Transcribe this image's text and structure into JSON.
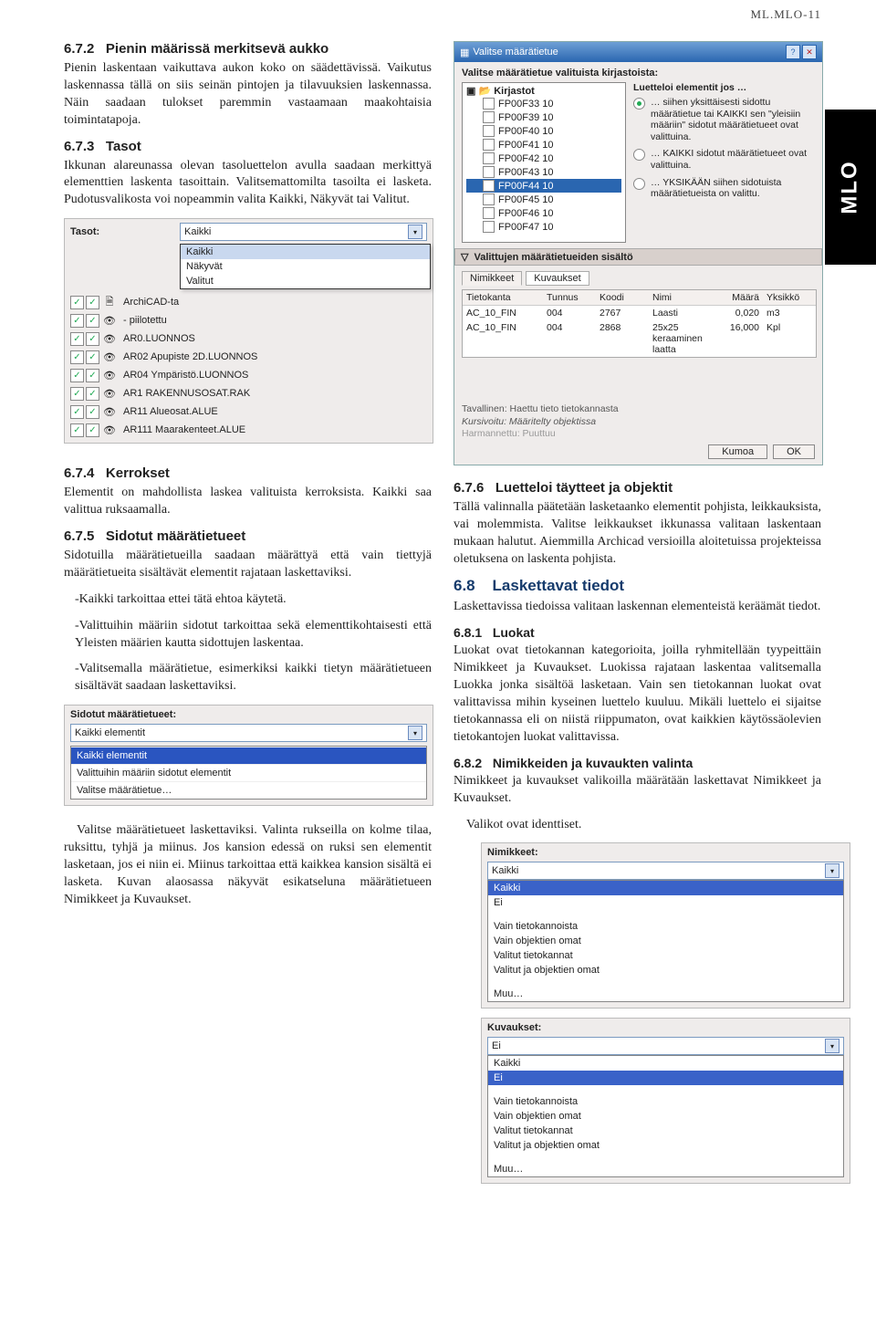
{
  "header_id": "ML.MLO-11",
  "side_tab": "MLO",
  "sec672": {
    "num": "6.7.2",
    "title": "Pienin määrissä merkitsevä aukko",
    "p": "Pienin laskentaan vaikuttava aukon koko on säädettävissä. Vaikutus laskennassa tällä on  siis seinän pintojen ja tilavuuksien laskennassa. Näin saadaan tulokset paremmin vastaamaan maakohtaisia toimintatapoja."
  },
  "sec673": {
    "num": "6.7.3",
    "title": "Tasot",
    "p": "Ikkunan alareunassa olevan tasoluettelon avulla saadaan merkittyä elementtien laskenta tasoittain. Valitsemattomilta tasoilta ei lasketa. Pudotusvalikosta voi nopeammin valita Kaikki, Näkyvät tai Valitut."
  },
  "tasot": {
    "label": "Tasot:",
    "value": "Kaikki",
    "options": [
      "Kaikki",
      "Näkyvät",
      "Valitut"
    ],
    "layers": [
      {
        "chk": true,
        "icon": "doc",
        "name": "ArchiCAD-ta"
      },
      {
        "chk": true,
        "icon": "eye",
        "name": "- piilotettu"
      },
      {
        "chk": true,
        "icon": "eye",
        "name": "AR0.LUONNOS"
      },
      {
        "chk": true,
        "icon": "eye",
        "name": "AR02 Apupiste 2D.LUONNOS"
      },
      {
        "chk": true,
        "icon": "eye",
        "name": "AR04 Ympäristö.LUONNOS"
      },
      {
        "chk": true,
        "icon": "eye",
        "name": "AR1 RAKENNUSOSAT.RAK"
      },
      {
        "chk": true,
        "icon": "eye",
        "name": "AR11 Alueosat.ALUE"
      },
      {
        "chk": true,
        "icon": "eye",
        "name": "AR111 Maarakenteet.ALUE"
      }
    ]
  },
  "sec674": {
    "num": "6.7.4",
    "title": "Kerrokset",
    "p": "Elementit on mahdollista laskea valituista kerroksista. Kaikki saa valittua ruksaamalla."
  },
  "sec675": {
    "num": "6.7.5",
    "title": "Sidotut määrätietueet",
    "p": "Sidotuilla määrätietueilla saadaan määrättyä että vain tiettyjä määrätietueita sisältävät elementit rajataan laskettaviksi.",
    "li1": "-Kaikki tarkoittaa ettei tätä ehtoa käytetä.",
    "li2": "-Valittuihin määriin sidotut tarkoittaa sekä elementtikohtaisesti että Yleisten määrien kautta sidottujen laskentaa.",
    "li3": "-Valitsemalla määrätietue, esimerkiksi kaikki tietyn määrätietueen sisältävät saadaan laskettaviksi."
  },
  "sidotut": {
    "label": "Sidotut määrätietueet:",
    "value": "Kaikki elementit",
    "rows": [
      "Kaikki elementit",
      "Valittuihin määriin sidotut elementit",
      "Valitse määrätietue…"
    ]
  },
  "sec675b": "Valitse määrätietueet laskettaviksi. Valinta rukseilla on kolme tilaa, ruksittu, tyhjä ja miinus. Jos kansion edessä on ruksi sen elementit lasketaan, jos ei niin ei. Miinus tarkoittaa että kaikkea kansion sisältä ei lasketa. Kuvan alaosassa näkyvät esikatseluna määrätietueen Nimikkeet ja Kuvaukset.",
  "dialog": {
    "title": "Valitse määrätietue",
    "lbl": "Valitse määrätietue valituista kirjastoista:",
    "root": "Kirjastot",
    "leaves": [
      "FP00F33 10",
      "FP00F39 10",
      "FP00F40 10",
      "FP00F41 10",
      "FP00F42 10",
      "FP00F43 10",
      "FP00F44 10",
      "FP00F45 10",
      "FP00F46 10",
      "FP00F47 10"
    ],
    "sel_leaf_index": 6,
    "radios_lbl": "Luetteloi elementit jos …",
    "radios": [
      "… siihen yksittäisesti sidottu määrätietue tai KAIKKI sen \"yleisiin määriin\" sidotut määrätietueet ovat valittuina.",
      "… KAIKKI sidotut määrätietueet ovat valittuina.",
      "… YKSIKÄÄN siihen sidotuista määrätietueista on valittu."
    ],
    "radio_on": 0,
    "section": "Valittujen määrätietueiden sisältö",
    "tabs": [
      "Nimikkeet",
      "Kuvaukset"
    ],
    "cols": [
      "Tietokanta",
      "Tunnus",
      "Koodi",
      "Nimi",
      "Määrä",
      "Yksikkö"
    ],
    "rows": [
      {
        "c1": "AC_10_FIN",
        "c2": "004",
        "c3": "2767",
        "c4": "Laasti",
        "c5": "0,020",
        "c6": "m3"
      },
      {
        "c1": "AC_10_FIN",
        "c2": "004",
        "c3": "2868",
        "c4": "25x25 keraaminen laatta",
        "c5": "16,000",
        "c6": "Kpl"
      }
    ],
    "notes": [
      "Tavallinen: Haettu tieto tietokannasta",
      "Kursivoitu: Määritelty objektissa",
      "Harmannettu: Puuttuu"
    ],
    "btn_cancel": "Kumoa",
    "btn_ok": "OK"
  },
  "sec676": {
    "num": "6.7.6",
    "title": "Luetteloi täytteet ja objektit",
    "p": "Tällä valinnalla päätetään lasketaanko elementit pohjista, leikkauksista, vai molemmista. Valitse leikkaukset ikkunassa valitaan laskentaan mukaan halutut. Aiemmilla Archicad versioilla aloitetuissa projekteissa oletuksena on laskenta pohjista."
  },
  "sec68": {
    "num": "6.8",
    "title": "Laskettavat tiedot",
    "p": "Laskettavissa tiedoissa valitaan laskennan elementeistä keräämät tiedot."
  },
  "sec681": {
    "num": "6.8.1",
    "title": "Luokat",
    "p": "Luokat ovat tietokannan kategorioita, joilla ryhmitellään tyypeittäin Nimikkeet ja Kuvaukset. Luokissa rajataan laskentaa valitsemalla Luokka jonka sisältöä lasketaan. Vain sen tietokannan luokat ovat valittavissa mihin kyseinen luettelo kuuluu. Mikäli luettelo ei sijaitse tietokannassa eli on niistä riippumaton, ovat kaikkien käytössäolevien tietokantojen luokat valittavissa."
  },
  "sec682": {
    "num": "6.8.2",
    "title": "Nimikkeiden ja kuvaukten valinta",
    "p": "Nimikkeet ja kuvaukset valikoilla määrätään laskettavat Nimikkeet ja Kuvaukset.",
    "p2": "Valikot ovat identtiset."
  },
  "nimik": {
    "label": "Nimikkeet:",
    "value": "Kaikki",
    "rows": [
      "Kaikki",
      "Ei",
      "",
      "Vain tietokannoista",
      "Vain objektien omat",
      "Valitut tietokannat",
      "Valitut ja objektien omat",
      "",
      "Muu…"
    ]
  },
  "kuva": {
    "label": "Kuvaukset:",
    "value": "Ei",
    "rows": [
      "Kaikki",
      "Ei",
      "",
      "Vain tietokannoista",
      "Vain objektien omat",
      "Valitut tietokannat",
      "Valitut ja objektien omat",
      "",
      "Muu…"
    ]
  }
}
